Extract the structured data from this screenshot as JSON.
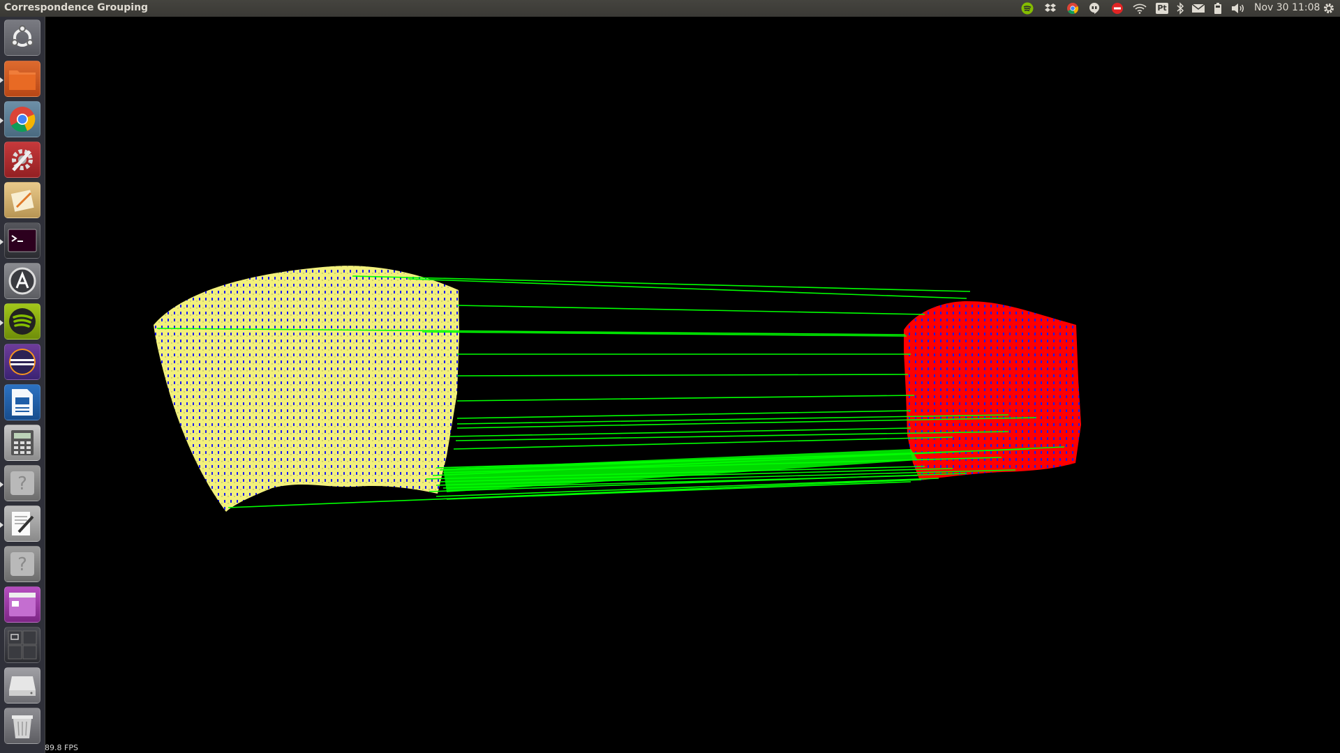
{
  "topbar": {
    "title": "Correspondence Grouping",
    "clock": "Nov 30 11:08",
    "tray_icons": [
      "spotify-tray-icon",
      "dropbox-tray-icon",
      "chrome-tray-icon",
      "hangouts-tray-icon",
      "do-not-disturb-icon",
      "wifi-icon",
      "keyboard-layout-icon",
      "bluetooth-icon",
      "mail-icon",
      "battery-icon",
      "volume-icon"
    ],
    "keyboard_layout": "Pt"
  },
  "launcher": {
    "items": [
      "ubuntu-dash",
      "files",
      "chrome",
      "system-settings",
      "text-editor-app",
      "terminal",
      "software-updater",
      "spotify",
      "eclipse",
      "libreoffice-writer",
      "calculator",
      "unknown-app",
      "gedit",
      "unknown-app-2",
      "workspace-app",
      "workspace-switcher",
      "drive",
      "trash"
    ]
  },
  "viewer": {
    "fps_label": "89.8 FPS",
    "colors": {
      "model_cloud": "#f2f07c",
      "scene_cloud": "#ff0000",
      "keypoints": "#0000ff",
      "correspondences": "#00ff00",
      "background": "#000000"
    }
  }
}
